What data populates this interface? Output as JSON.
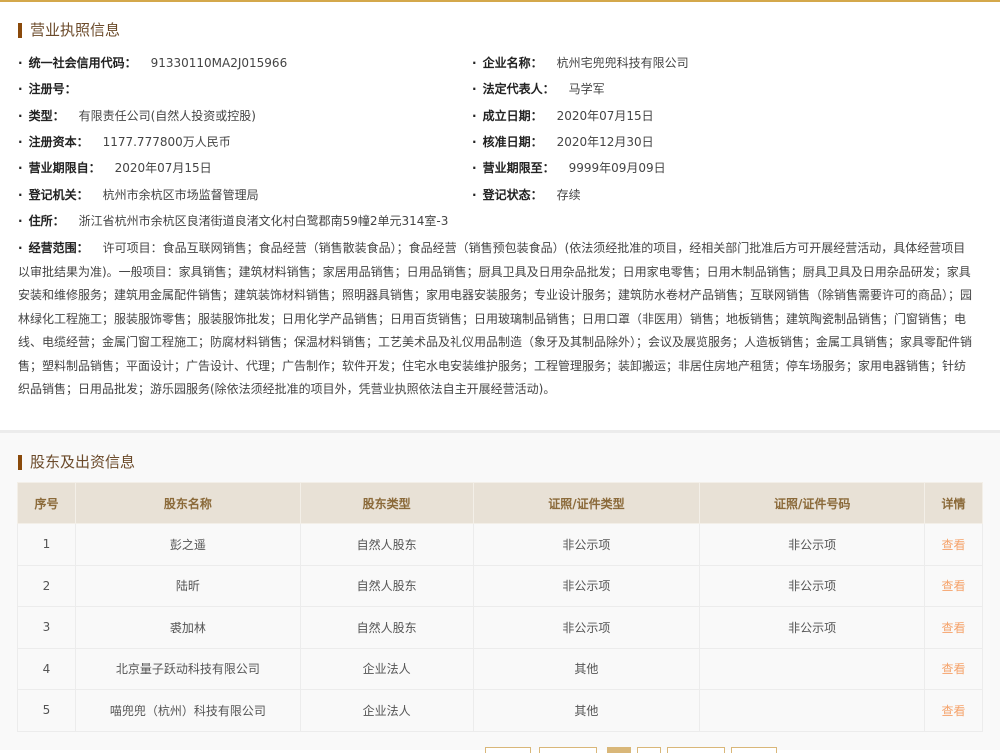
{
  "license_section": {
    "title": "营业执照信息",
    "left": [
      {
        "label": "统一社会信用代码：",
        "value": "91330110MA2J015966"
      },
      {
        "label": "注册号：",
        "value": ""
      },
      {
        "label": "类型：",
        "value": "有限责任公司(自然人投资或控股)"
      },
      {
        "label": "注册资本：",
        "value": "1177.777800万人民币"
      },
      {
        "label": "营业期限自：",
        "value": "2020年07月15日"
      },
      {
        "label": "登记机关：",
        "value": "杭州市余杭区市场监督管理局"
      },
      {
        "label": "住所：",
        "value": "浙江省杭州市余杭区良渚街道良渚文化村白鹭郡南59幢2单元314室-3"
      }
    ],
    "right": [
      {
        "label": "企业名称：",
        "value": "杭州宅兜兜科技有限公司"
      },
      {
        "label": "法定代表人：",
        "value": "马学军"
      },
      {
        "label": "成立日期：",
        "value": "2020年07月15日"
      },
      {
        "label": "核准日期：",
        "value": "2020年12月30日"
      },
      {
        "label": "营业期限至：",
        "value": "9999年09月09日"
      },
      {
        "label": "登记状态：",
        "value": "存续"
      }
    ],
    "scope_label": "经营范围：",
    "scope": "许可项目：食品互联网销售；食品经营（销售散装食品）；食品经营（销售预包装食品）(依法须经批准的项目，经相关部门批准后方可开展经营活动，具体经营项目以审批结果为准)。一般项目：家具销售；建筑材料销售；家居用品销售；日用品销售；厨具卫具及日用杂品批发；日用家电零售；日用木制品销售；厨具卫具及日用杂品研发；家具安装和维修服务；建筑用金属配件销售；建筑装饰材料销售；照明器具销售；家用电器安装服务；专业设计服务；建筑防水卷材产品销售；互联网销售（除销售需要许可的商品）；园林绿化工程施工；服装服饰零售；服装服饰批发；日用化学产品销售；日用百货销售；日用玻璃制品销售；日用口罩（非医用）销售；地板销售；建筑陶瓷制品销售；门窗销售；电线、电缆经营；金属门窗工程施工；防腐材料销售；保温材料销售；工艺美术品及礼仪用品制造（象牙及其制品除外）；会议及展览服务；人造板销售；金属工具销售；家具零配件销售；塑料制品销售；平面设计；广告设计、代理；广告制作；软件开发；住宅水电安装维护服务；工程管理服务；装卸搬运；非居住房地产租赁；停车场服务；家用电器销售；针纺织品销售；日用品批发；游乐园服务(除依法须经批准的项目外，凭营业执照依法自主开展经营活动)。"
  },
  "shareholder_section": {
    "title": "股东及出资信息",
    "headers": [
      "序号",
      "股东名称",
      "股东类型",
      "证照/证件类型",
      "证照/证件号码",
      "详情"
    ],
    "rows": [
      [
        "1",
        "彭之遥",
        "自然人股东",
        "非公示项",
        "非公示项",
        "查看"
      ],
      [
        "2",
        "陆昕",
        "自然人股东",
        "非公示项",
        "非公示项",
        "查看"
      ],
      [
        "3",
        "裘加林",
        "自然人股东",
        "非公示项",
        "非公示项",
        "查看"
      ],
      [
        "4",
        "北京量子跃动科技有限公司",
        "企业法人",
        "其他",
        "",
        "查看"
      ],
      [
        "5",
        "喵兜兜（杭州）科技有限公司",
        "企业法人",
        "其他",
        "",
        "查看"
      ]
    ]
  },
  "colors": {
    "accent": "#8a4a0b",
    "header_bg": "#e8e1d6",
    "link": "#f5a36b",
    "top_line": "#d4a84b"
  }
}
